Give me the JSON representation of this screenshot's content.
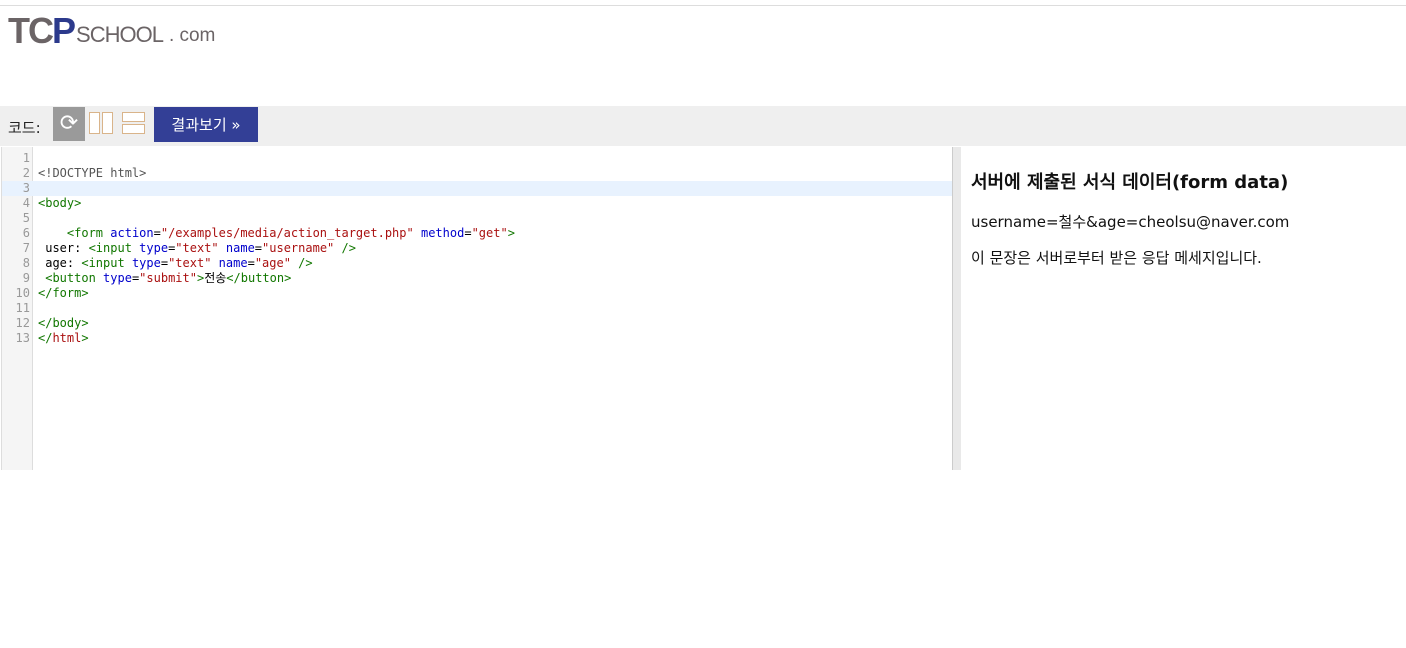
{
  "logo": {
    "tc": "TC",
    "p": "P",
    "school": "SCHOOL",
    "com": ". com"
  },
  "toolbar": {
    "label": "코드:",
    "refresh_icon": "refresh-icon",
    "columns_icon": "layout-columns-icon",
    "rows_icon": "layout-rows-icon",
    "run_label": "결과보기 »"
  },
  "editor": {
    "lines": [
      {
        "n": "1",
        "tokens": []
      },
      {
        "n": "2",
        "tokens": [
          [
            "t-meta",
            "<!DOCTYPE html>"
          ]
        ]
      },
      {
        "n": "3",
        "tokens": [],
        "active": true
      },
      {
        "n": "4",
        "tokens": [
          [
            "t-tag",
            "<body>"
          ]
        ]
      },
      {
        "n": "5",
        "tokens": []
      },
      {
        "n": "6",
        "tokens": [
          [
            "t-text",
            "    "
          ],
          [
            "t-tag",
            "<form "
          ],
          [
            "t-attr",
            "action"
          ],
          [
            "t-text",
            "="
          ],
          [
            "t-str",
            "\"/examples/media/action_target.php\""
          ],
          [
            "t-text",
            " "
          ],
          [
            "t-attr",
            "method"
          ],
          [
            "t-text",
            "="
          ],
          [
            "t-str",
            "\"get\""
          ],
          [
            "t-tag",
            ">"
          ]
        ]
      },
      {
        "n": "7",
        "tokens": [
          [
            "t-text",
            " user: "
          ],
          [
            "t-tag",
            "<input "
          ],
          [
            "t-attr",
            "type"
          ],
          [
            "t-text",
            "="
          ],
          [
            "t-str",
            "\"text\""
          ],
          [
            "t-text",
            " "
          ],
          [
            "t-attr",
            "name"
          ],
          [
            "t-text",
            "="
          ],
          [
            "t-str",
            "\"username\""
          ],
          [
            "t-text",
            " "
          ],
          [
            "t-tag",
            "/>"
          ]
        ]
      },
      {
        "n": "8",
        "tokens": [
          [
            "t-text",
            " age: "
          ],
          [
            "t-tag",
            "<input "
          ],
          [
            "t-attr",
            "type"
          ],
          [
            "t-text",
            "="
          ],
          [
            "t-str",
            "\"text\""
          ],
          [
            "t-text",
            " "
          ],
          [
            "t-attr",
            "name"
          ],
          [
            "t-text",
            "="
          ],
          [
            "t-str",
            "\"age\""
          ],
          [
            "t-text",
            " "
          ],
          [
            "t-tag",
            "/>"
          ]
        ]
      },
      {
        "n": "9",
        "tokens": [
          [
            "t-text",
            " "
          ],
          [
            "t-tag",
            "<button "
          ],
          [
            "t-attr",
            "type"
          ],
          [
            "t-text",
            "="
          ],
          [
            "t-str",
            "\"submit\""
          ],
          [
            "t-tag",
            ">"
          ],
          [
            "t-text",
            "전송"
          ],
          [
            "t-tag",
            "</button>"
          ]
        ]
      },
      {
        "n": "10",
        "tokens": [
          [
            "t-tag",
            "</form>"
          ]
        ]
      },
      {
        "n": "11",
        "tokens": []
      },
      {
        "n": "12",
        "tokens": [
          [
            "t-tag",
            "</body>"
          ]
        ]
      },
      {
        "n": "13",
        "tokens": [
          [
            "t-tag",
            "</"
          ],
          [
            "t-close",
            "html"
          ],
          [
            "t-tag",
            ">"
          ]
        ]
      }
    ]
  },
  "result": {
    "heading": "서버에 제출된 서식 데이터(form data)",
    "query": "username=철수&age=cheolsu@naver.com",
    "message": "이 문장은 서버로부터 받은 응답 메세지입니다."
  }
}
